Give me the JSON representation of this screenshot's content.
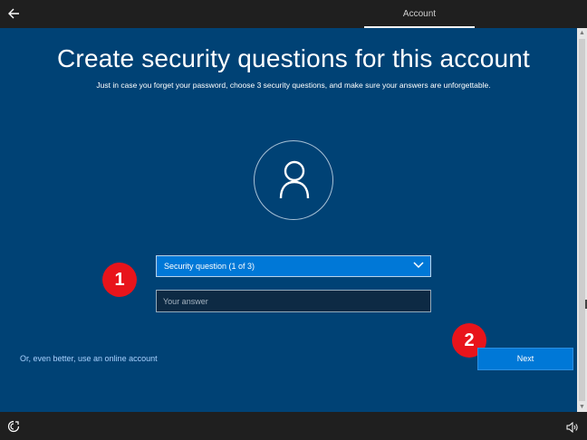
{
  "header": {
    "tab_label": "Account",
    "back_icon": "back-arrow-icon"
  },
  "page": {
    "title": "Create security questions for this account",
    "subtitle": "Just in case you forget your password, choose 3 security questions, and make sure your answers are unforgettable."
  },
  "avatar": {
    "icon": "user-icon"
  },
  "form": {
    "question_select_value": "Security question (1 of 3)",
    "answer_placeholder": "Your answer",
    "answer_value": ""
  },
  "links": {
    "online_account": "Or, even better, use an online account"
  },
  "buttons": {
    "next_label": "Next"
  },
  "annotations": {
    "marker_1": "1",
    "marker_2": "2"
  },
  "footer": {
    "left_icon": "ease-of-access-icon",
    "right_icon": "volume-icon"
  },
  "colors": {
    "background": "#004275",
    "accent": "#0078d7",
    "marker": "#e8141b",
    "chrome": "#1f1f1f"
  }
}
